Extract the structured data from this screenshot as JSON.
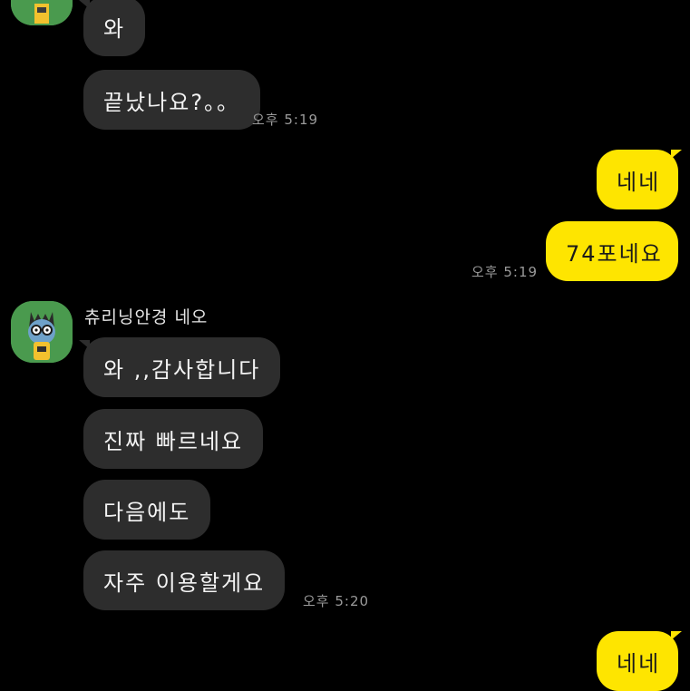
{
  "messages": {
    "m1": "와",
    "m2": "끝났나요?。。",
    "m3": "네네",
    "m4": "74포네요",
    "m5": "와 ,,감사합니다",
    "m6": "진짜 빠르네요",
    "m7": "다음에도",
    "m8": "자주 이용할게요",
    "m9": "네네"
  },
  "times": {
    "t1": "오후 5:19",
    "t2": "오후 5:19",
    "t3": "오후 5:20"
  },
  "sender": {
    "name": "츄리닝안경 네오",
    "avatar_icon": "neo-character-avatar-icon"
  },
  "colors": {
    "background": "#000000",
    "incoming_bubble": "#2d2d2d",
    "outgoing_bubble": "#fee500",
    "avatar_bg": "#4a9a4e"
  }
}
